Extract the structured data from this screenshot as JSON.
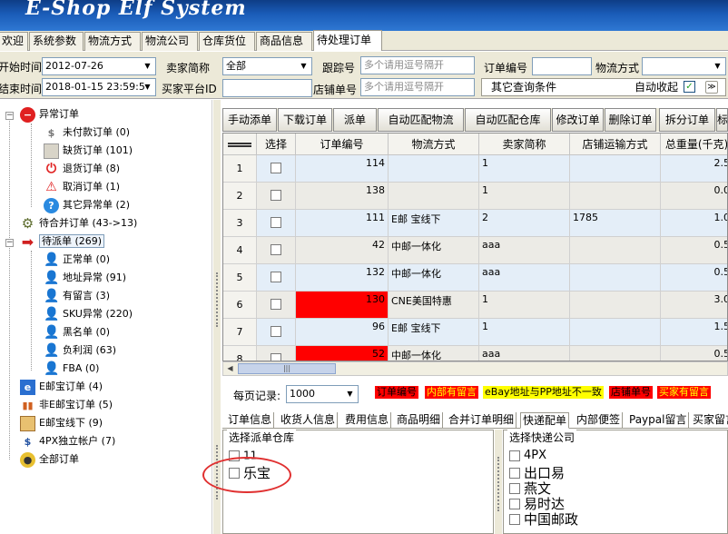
{
  "window": {
    "title": "E-Shop Elf  System"
  },
  "menu": {
    "tabs": [
      {
        "label": "欢迎"
      },
      {
        "label": "系统参数"
      },
      {
        "label": "物流方式"
      },
      {
        "label": "物流公司"
      },
      {
        "label": "仓库货位"
      },
      {
        "label": "商品信息"
      },
      {
        "label": "待处理订单",
        "active": true
      }
    ]
  },
  "filters": {
    "start_time_label": "开始时间",
    "start_time": "2012-07-26",
    "end_time_label": "结束时间",
    "end_time": "2018-01-15 23:59:5",
    "seller_label": "卖家简称",
    "seller_value": "全部",
    "buyer_id_label": "买家平台ID",
    "buyer_id_value": "",
    "tracking_label": "跟踪号",
    "tracking_placeholder": "多个请用逗号隔开",
    "store_order_label": "店铺单号",
    "store_order_placeholder": "多个请用逗号隔开",
    "order_no_label": "订单编号",
    "order_no_value": "",
    "shipping_label": "物流方式",
    "shipping_value": "",
    "other_conditions_label": "其它查询条件",
    "auto_collapse_label": "自动收起",
    "auto_collapse_checked": true
  },
  "sidebar": {
    "abnormal": {
      "label": "异常订单"
    },
    "abnormal_children": [
      {
        "label": "未付款订单 (0)"
      },
      {
        "label": "缺货订单 (101)"
      },
      {
        "label": "退货订单 (8)"
      },
      {
        "label": "取消订单 (1)"
      },
      {
        "label": "其它异常单 (2)"
      }
    ],
    "merge": {
      "label": "待合并订单 (43->13)"
    },
    "dispatch": {
      "label": "待派单 (269)"
    },
    "dispatch_children": [
      {
        "label": "正常单 (0)"
      },
      {
        "label": "地址异常 (91)"
      },
      {
        "label": "有留言 (3)"
      },
      {
        "label": "SKU异常 (220)"
      },
      {
        "label": "黑名单 (0)"
      },
      {
        "label": "负利润 (63)"
      },
      {
        "label": "FBA (0)"
      }
    ],
    "ebay": {
      "label": "E邮宝订单 (4)"
    },
    "non_ebay": {
      "label": "非E邮宝订单 (5)"
    },
    "ebay_offline": {
      "label": "E邮宝线下 (9)"
    },
    "fourpx": {
      "label": "4PX独立帐户 (7)"
    },
    "all": {
      "label": "全部订单"
    }
  },
  "toolbar": {
    "buttons": [
      {
        "label": "手动添单"
      },
      {
        "label": "下载订单"
      },
      {
        "label": "派单"
      },
      {
        "label": "自动匹配物流"
      },
      {
        "label": "自动匹配仓库"
      },
      {
        "label": "修改订单"
      },
      {
        "label": "删除订单"
      },
      {
        "label": "拆分订单"
      },
      {
        "label": "标"
      }
    ]
  },
  "grid": {
    "columns": [
      {
        "label": ""
      },
      {
        "label": "选择"
      },
      {
        "label": "订单编号"
      },
      {
        "label": "物流方式"
      },
      {
        "label": "卖家简称"
      },
      {
        "label": "店铺运输方式"
      },
      {
        "label": "总重量(千克)"
      }
    ],
    "rows": [
      {
        "no": "1",
        "order": "114",
        "shipping": "",
        "seller": "1",
        "store_ship": "",
        "weight": "2.5",
        "highlight": false
      },
      {
        "no": "2",
        "order": "138",
        "shipping": "",
        "seller": "1",
        "store_ship": "",
        "weight": "0.0",
        "highlight": false
      },
      {
        "no": "3",
        "order": "111",
        "shipping": "E邮 宝线下",
        "seller": "2",
        "store_ship": "1785",
        "weight": "1.0",
        "highlight": false
      },
      {
        "no": "4",
        "order": "42",
        "shipping": "中邮一体化",
        "seller": "aaa",
        "store_ship": "",
        "weight": "0.5",
        "highlight": false
      },
      {
        "no": "5",
        "order": "132",
        "shipping": "中邮一体化",
        "seller": "aaa",
        "store_ship": "",
        "weight": "0.5",
        "highlight": false
      },
      {
        "no": "6",
        "order": "130",
        "shipping": "CNE美国特惠",
        "seller": "1",
        "store_ship": "",
        "weight": "3.0",
        "highlight": true
      },
      {
        "no": "7",
        "order": "96",
        "shipping": "E邮 宝线下",
        "seller": "1",
        "store_ship": "",
        "weight": "1.5",
        "highlight": false
      },
      {
        "no": "8",
        "order": "52",
        "shipping": "中邮一体化",
        "seller": "aaa",
        "store_ship": "",
        "weight": "0.5",
        "highlight": true
      }
    ],
    "colors": {
      "odd_row": "#e4eef8",
      "even_row": "#ecebe6",
      "highlight": "#ff0000"
    }
  },
  "pager": {
    "label": "每页记录:",
    "value": "1000"
  },
  "legends": [
    {
      "label": "订单编号",
      "color": "#ff0000",
      "text_color": "#000000"
    },
    {
      "label": "内部有留言",
      "color": "#ff0000",
      "text_color": "#ffff00"
    },
    {
      "label": "eBay地址与PP地址不一致",
      "color": "#ffff00",
      "text_color": "#000000"
    },
    {
      "label": "店铺单号",
      "color": "#ff0000",
      "text_color": "#000000"
    },
    {
      "label": "买家有留言",
      "color": "#ff0000",
      "text_color": "#ffff00"
    }
  ],
  "bottom_tabs": [
    {
      "label": "订单信息"
    },
    {
      "label": "收货人信息"
    },
    {
      "label": "费用信息"
    },
    {
      "label": "商品明细"
    },
    {
      "label": "合并订单明细"
    },
    {
      "label": "快递配单",
      "active": true
    },
    {
      "label": "内部便签"
    },
    {
      "label": "Paypal留言"
    },
    {
      "label": "买家留言"
    }
  ],
  "warehouse_panel": {
    "title": "选择派单仓库",
    "options": [
      {
        "label": "11"
      },
      {
        "label": "乐宝"
      }
    ]
  },
  "express_panel": {
    "title": "选择快递公司",
    "options": [
      {
        "label": "4PX"
      },
      {
        "label": "出口易"
      },
      {
        "label": "燕文"
      },
      {
        "label": "易时达"
      },
      {
        "label": "中国邮政"
      }
    ]
  }
}
